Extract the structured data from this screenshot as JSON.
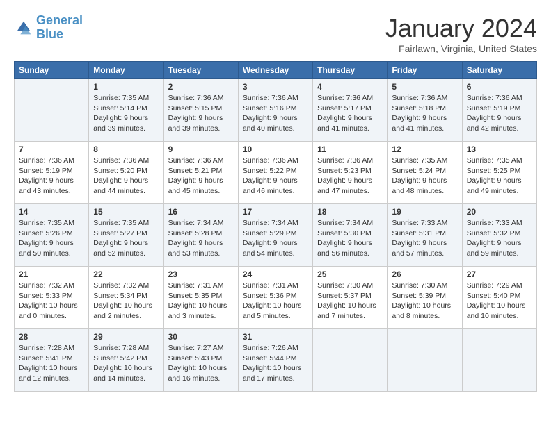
{
  "logo": {
    "line1": "General",
    "line2": "Blue"
  },
  "title": "January 2024",
  "location": "Fairlawn, Virginia, United States",
  "headers": [
    "Sunday",
    "Monday",
    "Tuesday",
    "Wednesday",
    "Thursday",
    "Friday",
    "Saturday"
  ],
  "weeks": [
    [
      {
        "day": "",
        "sunrise": "",
        "sunset": "",
        "daylight": ""
      },
      {
        "day": "1",
        "sunrise": "Sunrise: 7:35 AM",
        "sunset": "Sunset: 5:14 PM",
        "daylight": "Daylight: 9 hours and 39 minutes."
      },
      {
        "day": "2",
        "sunrise": "Sunrise: 7:36 AM",
        "sunset": "Sunset: 5:15 PM",
        "daylight": "Daylight: 9 hours and 39 minutes."
      },
      {
        "day": "3",
        "sunrise": "Sunrise: 7:36 AM",
        "sunset": "Sunset: 5:16 PM",
        "daylight": "Daylight: 9 hours and 40 minutes."
      },
      {
        "day": "4",
        "sunrise": "Sunrise: 7:36 AM",
        "sunset": "Sunset: 5:17 PM",
        "daylight": "Daylight: 9 hours and 41 minutes."
      },
      {
        "day": "5",
        "sunrise": "Sunrise: 7:36 AM",
        "sunset": "Sunset: 5:18 PM",
        "daylight": "Daylight: 9 hours and 41 minutes."
      },
      {
        "day": "6",
        "sunrise": "Sunrise: 7:36 AM",
        "sunset": "Sunset: 5:19 PM",
        "daylight": "Daylight: 9 hours and 42 minutes."
      }
    ],
    [
      {
        "day": "7",
        "sunrise": "Sunrise: 7:36 AM",
        "sunset": "Sunset: 5:19 PM",
        "daylight": "Daylight: 9 hours and 43 minutes."
      },
      {
        "day": "8",
        "sunrise": "Sunrise: 7:36 AM",
        "sunset": "Sunset: 5:20 PM",
        "daylight": "Daylight: 9 hours and 44 minutes."
      },
      {
        "day": "9",
        "sunrise": "Sunrise: 7:36 AM",
        "sunset": "Sunset: 5:21 PM",
        "daylight": "Daylight: 9 hours and 45 minutes."
      },
      {
        "day": "10",
        "sunrise": "Sunrise: 7:36 AM",
        "sunset": "Sunset: 5:22 PM",
        "daylight": "Daylight: 9 hours and 46 minutes."
      },
      {
        "day": "11",
        "sunrise": "Sunrise: 7:36 AM",
        "sunset": "Sunset: 5:23 PM",
        "daylight": "Daylight: 9 hours and 47 minutes."
      },
      {
        "day": "12",
        "sunrise": "Sunrise: 7:35 AM",
        "sunset": "Sunset: 5:24 PM",
        "daylight": "Daylight: 9 hours and 48 minutes."
      },
      {
        "day": "13",
        "sunrise": "Sunrise: 7:35 AM",
        "sunset": "Sunset: 5:25 PM",
        "daylight": "Daylight: 9 hours and 49 minutes."
      }
    ],
    [
      {
        "day": "14",
        "sunrise": "Sunrise: 7:35 AM",
        "sunset": "Sunset: 5:26 PM",
        "daylight": "Daylight: 9 hours and 50 minutes."
      },
      {
        "day": "15",
        "sunrise": "Sunrise: 7:35 AM",
        "sunset": "Sunset: 5:27 PM",
        "daylight": "Daylight: 9 hours and 52 minutes."
      },
      {
        "day": "16",
        "sunrise": "Sunrise: 7:34 AM",
        "sunset": "Sunset: 5:28 PM",
        "daylight": "Daylight: 9 hours and 53 minutes."
      },
      {
        "day": "17",
        "sunrise": "Sunrise: 7:34 AM",
        "sunset": "Sunset: 5:29 PM",
        "daylight": "Daylight: 9 hours and 54 minutes."
      },
      {
        "day": "18",
        "sunrise": "Sunrise: 7:34 AM",
        "sunset": "Sunset: 5:30 PM",
        "daylight": "Daylight: 9 hours and 56 minutes."
      },
      {
        "day": "19",
        "sunrise": "Sunrise: 7:33 AM",
        "sunset": "Sunset: 5:31 PM",
        "daylight": "Daylight: 9 hours and 57 minutes."
      },
      {
        "day": "20",
        "sunrise": "Sunrise: 7:33 AM",
        "sunset": "Sunset: 5:32 PM",
        "daylight": "Daylight: 9 hours and 59 minutes."
      }
    ],
    [
      {
        "day": "21",
        "sunrise": "Sunrise: 7:32 AM",
        "sunset": "Sunset: 5:33 PM",
        "daylight": "Daylight: 10 hours and 0 minutes."
      },
      {
        "day": "22",
        "sunrise": "Sunrise: 7:32 AM",
        "sunset": "Sunset: 5:34 PM",
        "daylight": "Daylight: 10 hours and 2 minutes."
      },
      {
        "day": "23",
        "sunrise": "Sunrise: 7:31 AM",
        "sunset": "Sunset: 5:35 PM",
        "daylight": "Daylight: 10 hours and 3 minutes."
      },
      {
        "day": "24",
        "sunrise": "Sunrise: 7:31 AM",
        "sunset": "Sunset: 5:36 PM",
        "daylight": "Daylight: 10 hours and 5 minutes."
      },
      {
        "day": "25",
        "sunrise": "Sunrise: 7:30 AM",
        "sunset": "Sunset: 5:37 PM",
        "daylight": "Daylight: 10 hours and 7 minutes."
      },
      {
        "day": "26",
        "sunrise": "Sunrise: 7:30 AM",
        "sunset": "Sunset: 5:39 PM",
        "daylight": "Daylight: 10 hours and 8 minutes."
      },
      {
        "day": "27",
        "sunrise": "Sunrise: 7:29 AM",
        "sunset": "Sunset: 5:40 PM",
        "daylight": "Daylight: 10 hours and 10 minutes."
      }
    ],
    [
      {
        "day": "28",
        "sunrise": "Sunrise: 7:28 AM",
        "sunset": "Sunset: 5:41 PM",
        "daylight": "Daylight: 10 hours and 12 minutes."
      },
      {
        "day": "29",
        "sunrise": "Sunrise: 7:28 AM",
        "sunset": "Sunset: 5:42 PM",
        "daylight": "Daylight: 10 hours and 14 minutes."
      },
      {
        "day": "30",
        "sunrise": "Sunrise: 7:27 AM",
        "sunset": "Sunset: 5:43 PM",
        "daylight": "Daylight: 10 hours and 16 minutes."
      },
      {
        "day": "31",
        "sunrise": "Sunrise: 7:26 AM",
        "sunset": "Sunset: 5:44 PM",
        "daylight": "Daylight: 10 hours and 17 minutes."
      },
      {
        "day": "",
        "sunrise": "",
        "sunset": "",
        "daylight": ""
      },
      {
        "day": "",
        "sunrise": "",
        "sunset": "",
        "daylight": ""
      },
      {
        "day": "",
        "sunrise": "",
        "sunset": "",
        "daylight": ""
      }
    ]
  ]
}
